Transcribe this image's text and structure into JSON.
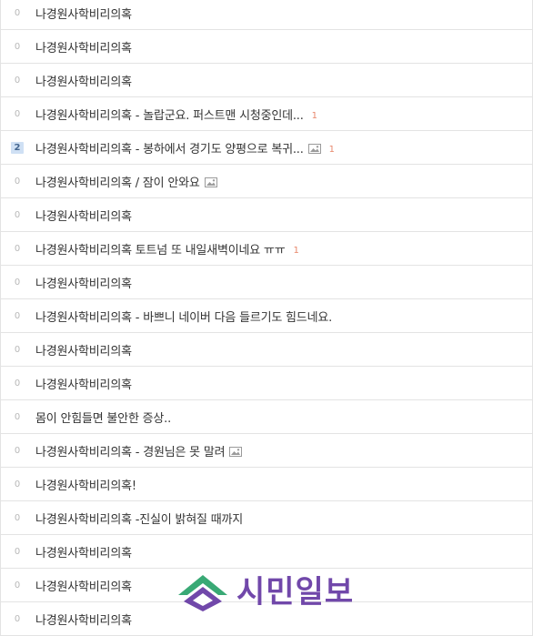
{
  "rows": [
    {
      "count": "0",
      "title": "나경원사학비리의혹",
      "image": false,
      "comments": ""
    },
    {
      "count": "0",
      "title": "나경원사학비리의혹",
      "image": false,
      "comments": ""
    },
    {
      "count": "0",
      "title": "나경원사학비리의혹",
      "image": false,
      "comments": ""
    },
    {
      "count": "0",
      "title": "나경원사학비리의혹 - 놀랍군요. 퍼스트맨 시청중인데...",
      "image": false,
      "comments": "1"
    },
    {
      "count": "2",
      "title": "나경원사학비리의혹 - 봉하에서 경기도 양평으로 복귀...",
      "image": true,
      "comments": "1",
      "hot": true
    },
    {
      "count": "0",
      "title": "나경원사학비리의혹 / 잠이 안와요",
      "image": true,
      "comments": ""
    },
    {
      "count": "0",
      "title": "나경원사학비리의혹",
      "image": false,
      "comments": ""
    },
    {
      "count": "0",
      "title": "나경원사학비리의혹 토트넘 또 내일새벽이네요 ㅠㅠ",
      "image": false,
      "comments": "1"
    },
    {
      "count": "0",
      "title": "나경원사학비리의혹",
      "image": false,
      "comments": ""
    },
    {
      "count": "0",
      "title": "나경원사학비리의혹 - 바쁘니 네이버 다음 들르기도 힘드네요.",
      "image": false,
      "comments": ""
    },
    {
      "count": "0",
      "title": "나경원사학비리의혹",
      "image": false,
      "comments": ""
    },
    {
      "count": "0",
      "title": "나경원사학비리의혹",
      "image": false,
      "comments": ""
    },
    {
      "count": "0",
      "title": "몸이 안힘들면 불안한 증상..",
      "image": false,
      "comments": ""
    },
    {
      "count": "0",
      "title": "나경원사학비리의혹 - 경원님은 못 말려",
      "image": true,
      "comments": ""
    },
    {
      "count": "0",
      "title": "나경원사학비리의혹!",
      "image": false,
      "comments": ""
    },
    {
      "count": "0",
      "title": "나경원사학비리의혹 -진실이 밝혀질 때까지",
      "image": false,
      "comments": ""
    },
    {
      "count": "0",
      "title": "나경원사학비리의혹",
      "image": false,
      "comments": ""
    },
    {
      "count": "0",
      "title": "나경원사학비리의혹",
      "image": false,
      "comments": ""
    },
    {
      "count": "0",
      "title": "나경원사학비리의혹",
      "image": false,
      "comments": ""
    }
  ],
  "watermark": {
    "text": "시민일보",
    "color": "#6a3fa6"
  },
  "colors": {
    "comment": "#e8886c",
    "hot_badge_bg": "#cfe0f4",
    "border": "#e3e3e3"
  }
}
